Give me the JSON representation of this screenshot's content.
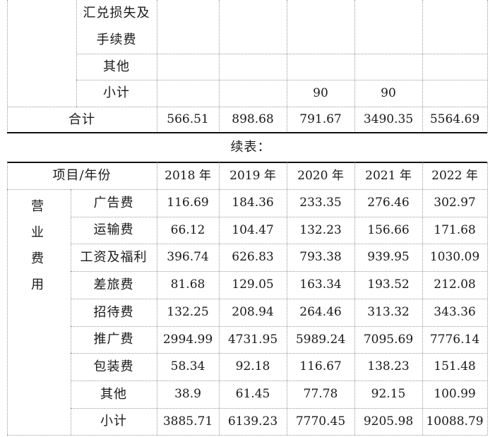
{
  "top_table": {
    "rows": [
      {
        "label": "汇兑损失及",
        "values": [
          "",
          "",
          "",
          "",
          ""
        ]
      },
      {
        "label": "手续费",
        "values": [
          "",
          "",
          "",
          "",
          ""
        ]
      },
      {
        "label": "其他",
        "values": [
          "",
          "",
          "",
          "",
          ""
        ]
      },
      {
        "label": "小计",
        "values": [
          "",
          "",
          "90",
          "90",
          ""
        ]
      }
    ],
    "total": {
      "label": "合计",
      "values": [
        "566.51",
        "898.68",
        "791.67",
        "3490.35",
        "5564.69"
      ]
    }
  },
  "continued_label": "续表：",
  "bottom_table": {
    "header": {
      "item_label": "项目/年份",
      "years": [
        "2018 年",
        "2019 年",
        "2020 年",
        "2021 年",
        "2022 年"
      ]
    },
    "group_label": [
      "营",
      "业",
      "费",
      "用"
    ],
    "rows": [
      {
        "label": "广告费",
        "values": [
          "116.69",
          "184.36",
          "233.35",
          "276.46",
          "302.97"
        ]
      },
      {
        "label": "运输费",
        "values": [
          "66.12",
          "104.47",
          "132.23",
          "156.66",
          "171.68"
        ]
      },
      {
        "label": "工资及福利",
        "values": [
          "396.74",
          "626.83",
          "793.38",
          "939.95",
          "1030.09"
        ]
      },
      {
        "label": "差旅费",
        "values": [
          "81.68",
          "129.05",
          "163.34",
          "193.52",
          "212.08"
        ]
      },
      {
        "label": "招待费",
        "values": [
          "132.25",
          "208.94",
          "264.46",
          "313.32",
          "343.36"
        ]
      },
      {
        "label": "推广费",
        "values": [
          "2994.99",
          "4731.95",
          "5989.24",
          "7095.69",
          "7776.14"
        ]
      },
      {
        "label": "包装费",
        "values": [
          "58.34",
          "92.18",
          "116.67",
          "138.23",
          "151.48"
        ]
      },
      {
        "label": "其他",
        "values": [
          "38.9",
          "61.45",
          "77.78",
          "92.15",
          "100.99"
        ]
      },
      {
        "label": "小计",
        "values": [
          "3885.71",
          "6139.23",
          "7770.45",
          "9205.98",
          "10088.79"
        ]
      }
    ]
  }
}
